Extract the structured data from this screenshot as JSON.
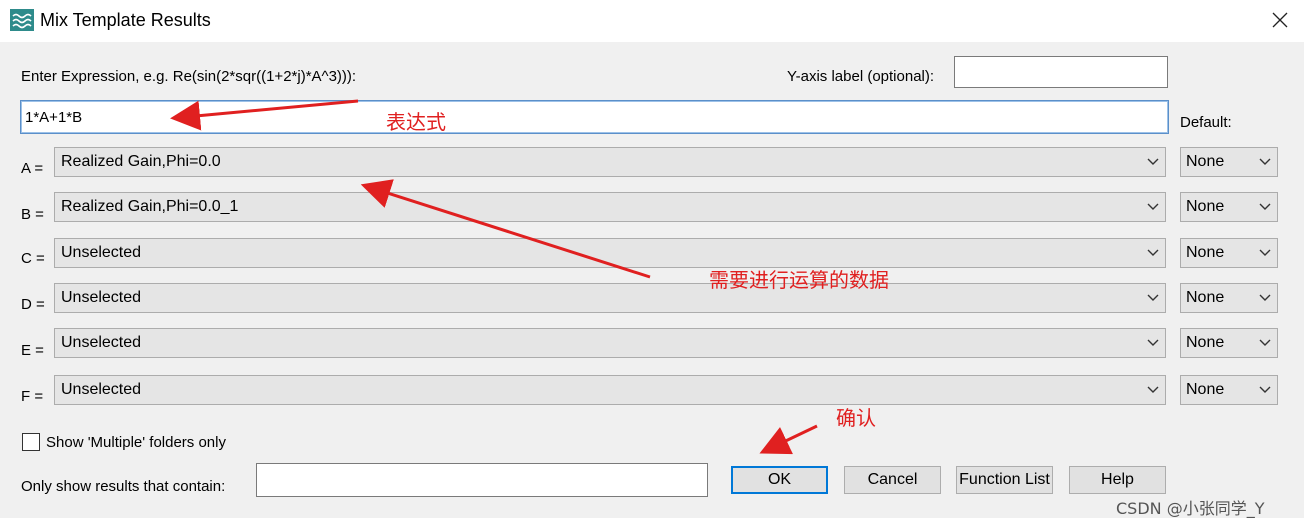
{
  "window": {
    "title": "Mix Template Results",
    "icon": "waves-icon"
  },
  "expression": {
    "label": "Enter Expression, e.g. Re(sin(2*sqr((1+2*j)*A^3))):",
    "value": "1*A+1*B"
  },
  "y_axis": {
    "label": "Y-axis label (optional):",
    "value": ""
  },
  "default_label": "Default:",
  "variables": [
    {
      "label": "A =",
      "selection": "Realized Gain,Phi=0.0",
      "default": "None"
    },
    {
      "label": "B =",
      "selection": "Realized Gain,Phi=0.0_1",
      "default": "None"
    },
    {
      "label": "C =",
      "selection": "Unselected",
      "default": "None"
    },
    {
      "label": "D =",
      "selection": "Unselected",
      "default": "None"
    },
    {
      "label": "E =",
      "selection": "Unselected",
      "default": "None"
    },
    {
      "label": "F =",
      "selection": "Unselected",
      "default": "None"
    }
  ],
  "show_multiple": {
    "label": "Show 'Multiple' folders only",
    "checked": false
  },
  "filter": {
    "label": "Only show results that contain:",
    "value": ""
  },
  "buttons": {
    "ok": "OK",
    "cancel": "Cancel",
    "function_list": "Function List",
    "help": "Help"
  },
  "annotations": {
    "expression": "表达式",
    "data": "需要进行运算的数据",
    "confirm": "确认",
    "color": "#e02020"
  },
  "watermark": "CSDN @小张同学_Y"
}
